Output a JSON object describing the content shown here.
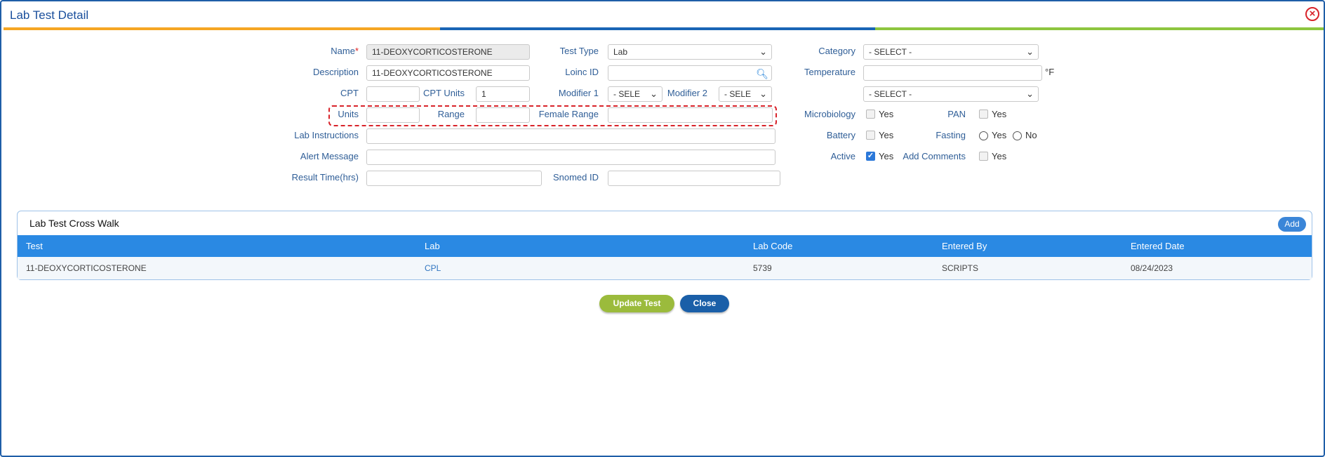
{
  "window": {
    "title": "Lab Test Detail"
  },
  "form": {
    "name": {
      "label": "Name",
      "required_mark": "*",
      "value": "11-DEOXYCORTICOSTERONE"
    },
    "description": {
      "label": "Description",
      "value": "11-DEOXYCORTICOSTERONE"
    },
    "cpt": {
      "label": "CPT",
      "value": ""
    },
    "cpt_units": {
      "label": "CPT Units",
      "value": "1"
    },
    "units": {
      "label": "Units",
      "value": ""
    },
    "range": {
      "label": "Range",
      "value": ""
    },
    "female_range": {
      "label": "Female Range",
      "value": ""
    },
    "lab_instructions": {
      "label": "Lab Instructions",
      "value": ""
    },
    "alert_message": {
      "label": "Alert Message",
      "value": ""
    },
    "result_time": {
      "label": "Result Time(hrs)",
      "value": ""
    },
    "test_type": {
      "label": "Test Type",
      "value": "Lab"
    },
    "loinc_id": {
      "label": "Loinc ID",
      "value": ""
    },
    "modifier1": {
      "label": "Modifier 1",
      "value": "- SELE"
    },
    "modifier2": {
      "label": "Modifier 2",
      "value": "- SELE"
    },
    "snomed_id": {
      "label": "Snomed ID",
      "value": ""
    },
    "category": {
      "label": "Category",
      "value": "- SELECT -"
    },
    "temperature": {
      "label": "Temperature",
      "value": "",
      "unit": "°F"
    },
    "temperature_select": {
      "value": "- SELECT -"
    },
    "microbiology": {
      "label": "Microbiology",
      "option": "Yes",
      "checked": false
    },
    "pan": {
      "label": "PAN",
      "option": "Yes",
      "checked": false
    },
    "battery": {
      "label": "Battery",
      "option": "Yes",
      "checked": false
    },
    "fasting": {
      "label": "Fasting",
      "yes": "Yes",
      "no": "No"
    },
    "active": {
      "label": "Active",
      "option": "Yes",
      "checked": true
    },
    "add_comments": {
      "label": "Add Comments",
      "option": "Yes",
      "checked": false
    }
  },
  "crosswalk": {
    "title": "Lab Test Cross Walk",
    "add_label": "Add",
    "columns": [
      "Test",
      "Lab",
      "Lab Code",
      "Entered By",
      "Entered Date"
    ],
    "rows": [
      {
        "test": "11-DEOXYCORTICOSTERONE",
        "lab": "CPL",
        "lab_code": "5739",
        "entered_by": "SCRIPTS",
        "entered_date": "08/24/2023"
      }
    ]
  },
  "actions": {
    "update_label": "Update Test",
    "close_label": "Close"
  },
  "colors": {
    "accent_orange": "#f5a623",
    "accent_blue": "#1a65b5",
    "accent_green": "#8dc63f",
    "table_header": "#2a89e3"
  }
}
